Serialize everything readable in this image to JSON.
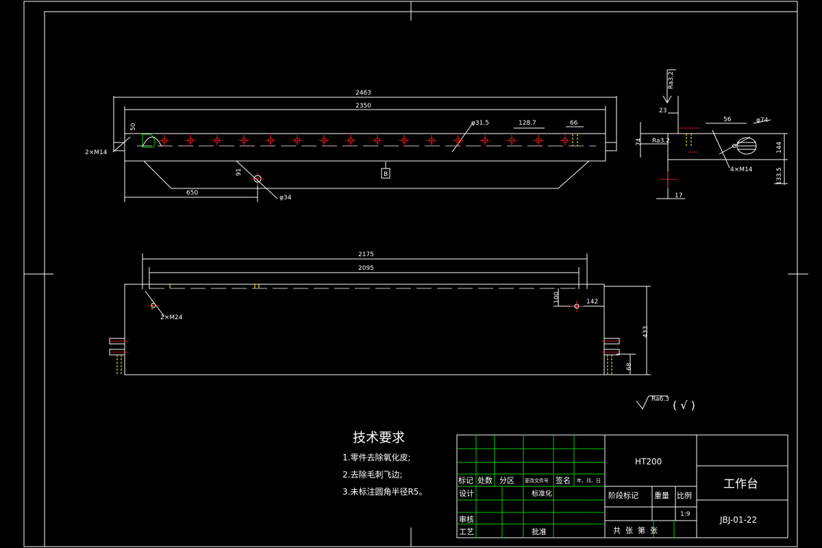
{
  "drawing": {
    "dimensions": {
      "top_overall": "2463",
      "top_inner": "2350",
      "top_left_height": "50",
      "top_tap": "2×M14",
      "top_hole_dia": "φ31.5",
      "top_pitch": "128.7",
      "top_end": "66",
      "top_offset": "650",
      "top_hole_small": "φ34",
      "top_hole_height": "91",
      "datum": "B",
      "side_roughness": "Ra3.2",
      "side_23": "23",
      "side_56": "56",
      "side_dia": "φ74",
      "side_74": "74",
      "side_ra": "Ra3.2",
      "side_tap": "4×M14",
      "side_144": "144",
      "side_133": "133.5",
      "side_17": "17",
      "front_overall": "2175",
      "front_inner": "2095",
      "front_100": "100",
      "front_142": "142",
      "front_tap": "2×M24",
      "front_433": "433",
      "front_68": "68",
      "general_roughness": "Ra6.3",
      "general_check": "( √ )"
    }
  },
  "tech": {
    "title": "技术要求",
    "items": [
      "1.零件去除氧化皮;",
      "2.去除毛刺飞边;",
      "3.未标注圆角半径R5。"
    ]
  },
  "titleblock": {
    "material": "HT200",
    "name": "工作台",
    "code": "JBJ-01-22",
    "scale": "1:9",
    "h_mark": "标记",
    "h_count": "处数",
    "h_zone": "分区",
    "h_doc": "更改文件号",
    "h_sign": "签名",
    "h_date": "年、月、日",
    "design": "设计",
    "standard": "标准化",
    "stage": "阶段标记",
    "weight": "重量",
    "ratio": "比例",
    "check": "审核",
    "process": "工艺",
    "approve": "批准",
    "sheets": "共  张  第  张"
  }
}
